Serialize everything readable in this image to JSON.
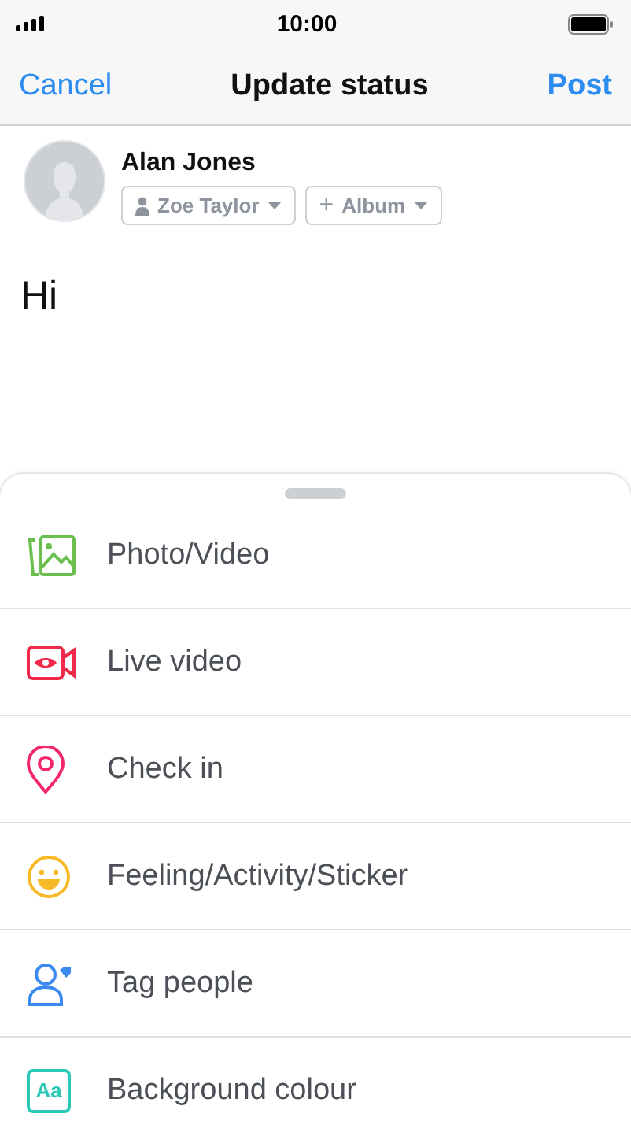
{
  "status_bar": {
    "time": "10:00"
  },
  "nav": {
    "cancel": "Cancel",
    "title": "Update status",
    "post": "Post"
  },
  "author": {
    "name": "Alan Jones",
    "audience": "Zoe Taylor",
    "album": "Album",
    "album_icon": "+"
  },
  "post_text": "Hi",
  "actions": [
    {
      "kind": "photo",
      "label": "Photo/Video",
      "color": "#6bbf4e"
    },
    {
      "kind": "live",
      "label": "Live video",
      "color": "#f02849"
    },
    {
      "kind": "checkin",
      "label": "Check in",
      "color": "#f3266e"
    },
    {
      "kind": "feeling",
      "label": "Feeling/Activity/Sticker",
      "color": "#f7b928"
    },
    {
      "kind": "tag",
      "label": "Tag people",
      "color": "#3b88f0"
    },
    {
      "kind": "background",
      "label": "Background colour",
      "color": "#2ac9b6",
      "icon_text": "Aa"
    }
  ]
}
